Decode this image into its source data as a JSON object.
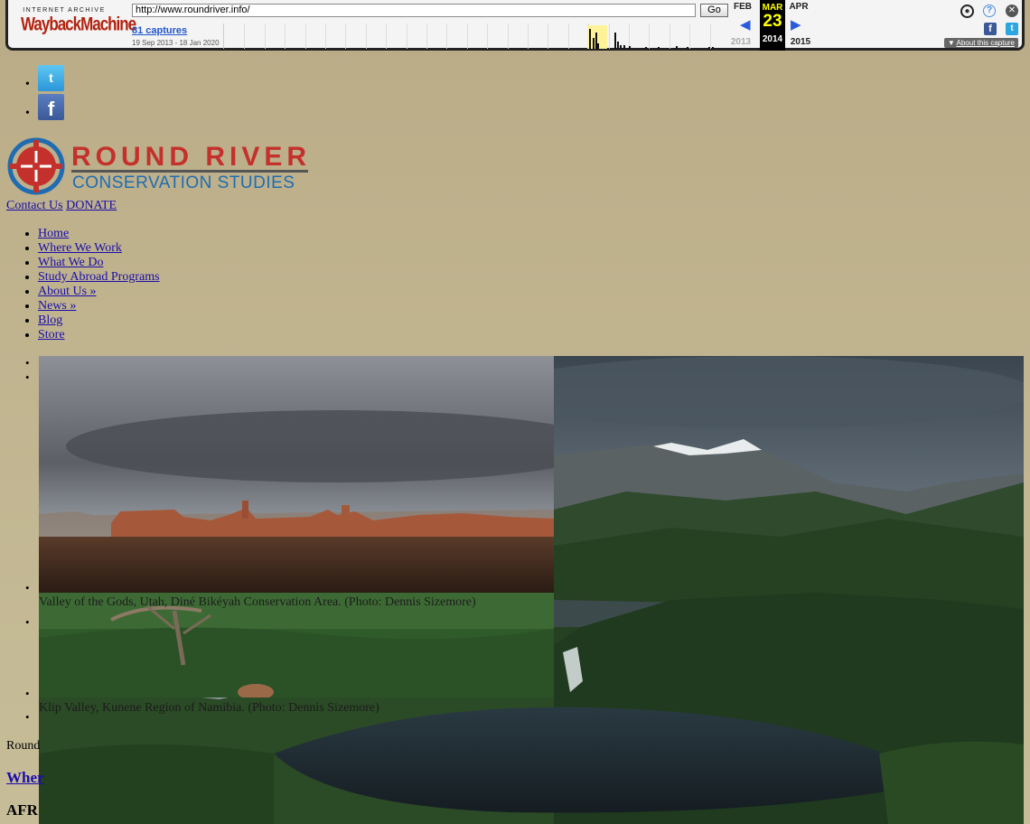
{
  "wayback": {
    "logo_top": "INTERNET ARCHIVE",
    "logo_main": "WaybackMachine",
    "url": "http://www.roundriver.info/",
    "go_label": "Go",
    "captures": "81 captures",
    "date_range": "19 Sep 2013 - 18 Jan 2020",
    "prev_month": "FEB",
    "cur_month": "MAR",
    "next_month": "APR",
    "cur_day": "23",
    "prev_year": "2013",
    "cur_year": "2014",
    "next_year": "2015",
    "about": "About this capture"
  },
  "social": {
    "twitter_glyph": "t",
    "facebook_glyph": "f"
  },
  "logo": {
    "line1": "ROUND RIVER",
    "line2": "CONSERVATION STUDIES",
    "colors": {
      "red": "#c4302b",
      "blue": "#1f6cb2"
    }
  },
  "topnav": {
    "contact": "Contact Us",
    "donate": "DONATE"
  },
  "mainnav": [
    "Home",
    "Where We Work",
    "What We Do",
    "Study Abroad Programs",
    "About Us »",
    "News »",
    "Blog",
    "Store"
  ],
  "slides": {
    "caption1": "Valley of the Gods, Utah, Diné Bikéyah Conservation Area. (Photo: Dennis Sizemore)",
    "caption2": "Klip Valley, Kunene Region of Namibia. (Photo: Dennis Sizemore)"
  },
  "body": {
    "round": "Round",
    "where": "Wher",
    "afr": "AFR"
  }
}
